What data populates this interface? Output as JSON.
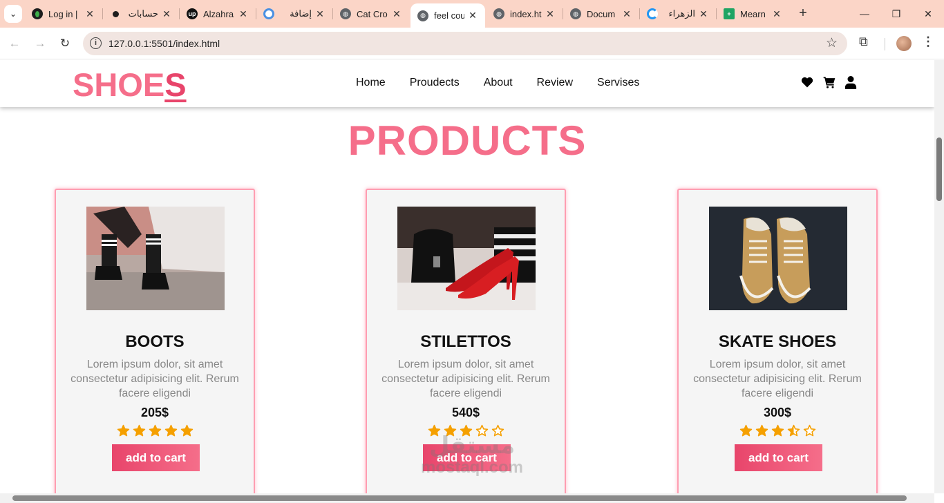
{
  "browser": {
    "tabs": [
      {
        "title": "Log in |",
        "favicon_color": "#1e1e1e",
        "active": false
      },
      {
        "title": "حسابات",
        "favicon_color": "#1e1e1e",
        "active": false
      },
      {
        "title": "Alzahra",
        "favicon_color": "#111111",
        "active": false
      },
      {
        "title": "إضافة",
        "favicon_color": "#4a90e2",
        "active": false
      },
      {
        "title": "Cat Cro",
        "favicon_color": "#5f6368",
        "active": false
      },
      {
        "title": "feel cou",
        "favicon_color": "#5f6368",
        "active": true
      },
      {
        "title": "index.ht",
        "favicon_color": "#5f6368",
        "active": false
      },
      {
        "title": "Docum",
        "favicon_color": "#5f6368",
        "active": false
      },
      {
        "title": "الزهراء",
        "favicon_color": "#2196f3",
        "active": false
      },
      {
        "title": "Mearn",
        "favicon_color": "#1fa463",
        "active": false
      }
    ],
    "url": "127.0.0.1:5501/index.html",
    "new_tab": "+",
    "win_minimize": "—",
    "win_restore": "❐",
    "win_close": "✕"
  },
  "site": {
    "logo_main": "SHOE",
    "logo_last": "S",
    "nav": [
      "Home",
      "Proudects",
      "About",
      "Review",
      "Servises"
    ],
    "page_title": "PRODUCTS",
    "accent": "#f56e8a",
    "accent_dark": "#e8456b",
    "star_color": "#f5a000"
  },
  "products": [
    {
      "name": "BOOTS",
      "description": "Lorem ipsum dolor, sit amet consectetur adipisicing elit. Rerum facere eligendi",
      "price": "205$",
      "rating": 5,
      "button": "add to cart",
      "image": "boots-photo"
    },
    {
      "name": "STILETTOS",
      "description": "Lorem ipsum dolor, sit amet consectetur adipisicing elit. Rerum facere eligendi",
      "price": "540$",
      "rating": 3,
      "button": "add to cart",
      "image": "stilettos-photo"
    },
    {
      "name": "SKATE SHOES",
      "description": "Lorem ipsum dolor, sit amet consectetur adipisicing elit. Rerum facere eligendi",
      "price": "300$",
      "rating": 3.5,
      "button": "add to cart",
      "image": "skate-shoes-photo"
    }
  ],
  "watermark": {
    "arabic": "مستقل",
    "latin": "mostaql.com"
  }
}
